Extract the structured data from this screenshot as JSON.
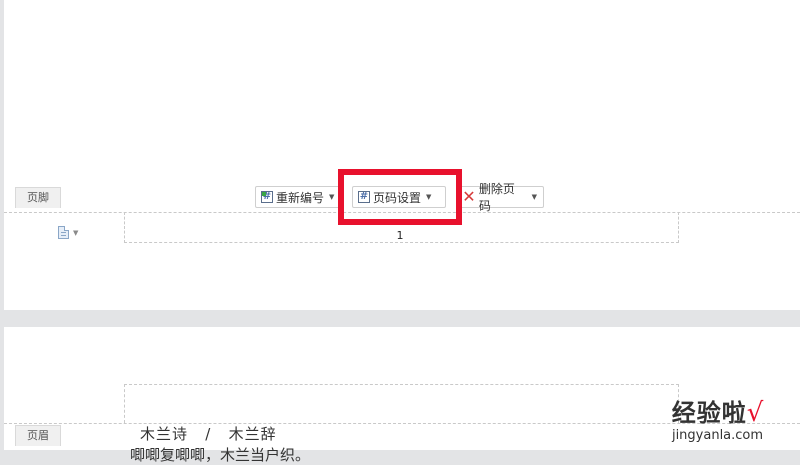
{
  "footer": {
    "tag_label": "页脚",
    "page_number": "1",
    "toolbar": {
      "renumber_label": "重新编号",
      "page_number_settings_label": "页码设置",
      "delete_page_number_label": "删除页码"
    }
  },
  "header": {
    "tag_label": "页眉"
  },
  "body": {
    "title_line": "木兰诗   /   木兰辞",
    "partial_line": "唧唧复唧唧，木兰当户织。"
  },
  "watermark": {
    "brand": "经验啦",
    "check_mark": "√",
    "domain": "jingyanla.com"
  },
  "colors": {
    "highlight": "#e8112d",
    "page_background": "#ffffff",
    "canvas_background": "#e3e4e6"
  },
  "icons": [
    "grid-renumber-icon",
    "grid-settings-icon",
    "delete-x-icon",
    "document-icon",
    "caret-down-icon"
  ]
}
